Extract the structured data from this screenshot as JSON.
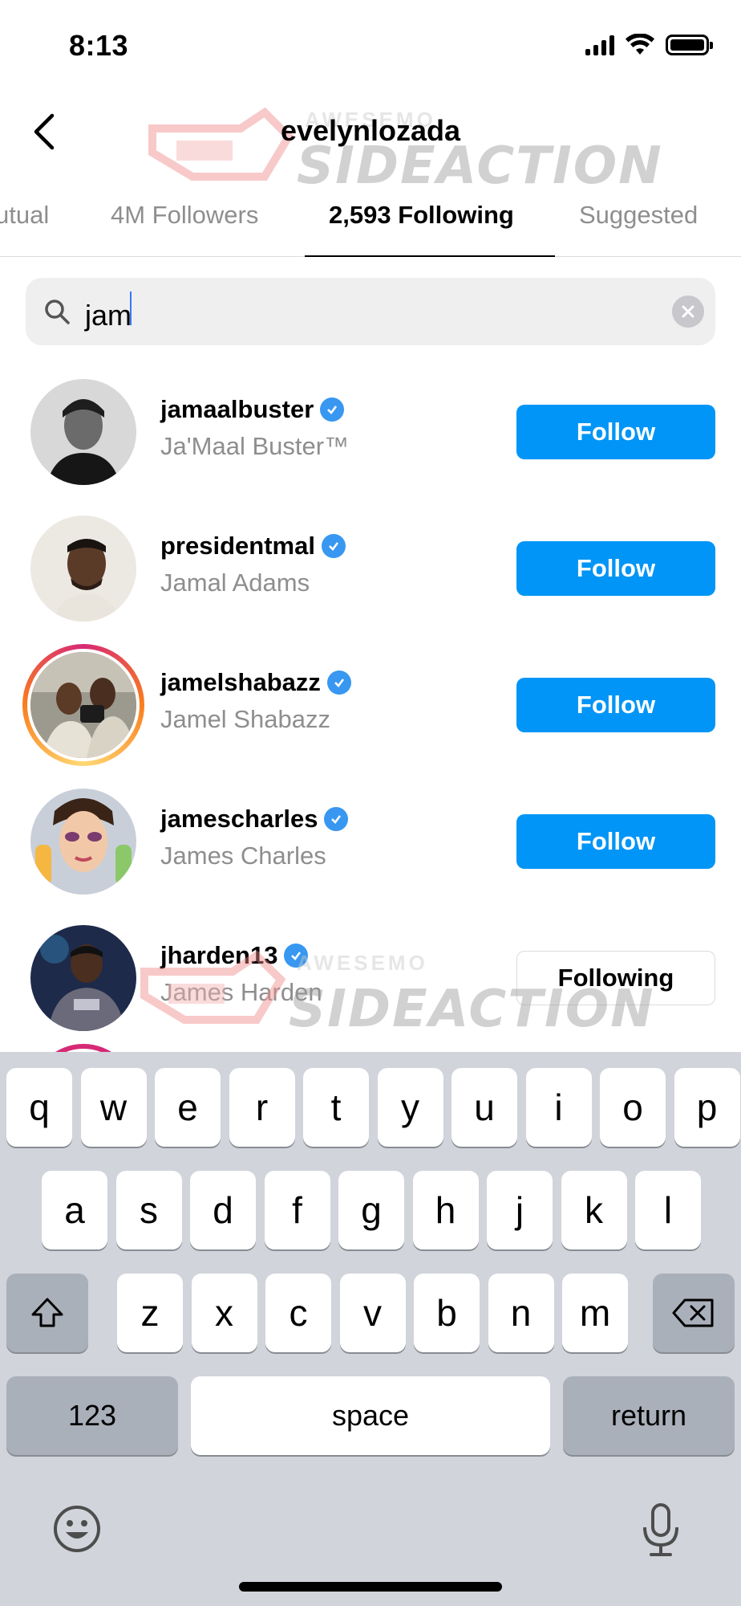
{
  "status_bar": {
    "time": "8:13"
  },
  "header": {
    "title": "evelynlozada"
  },
  "tabs": [
    {
      "label": "utual"
    },
    {
      "label": "4M Followers"
    },
    {
      "label": "2,593 Following",
      "active": true
    },
    {
      "label": "Suggested"
    }
  ],
  "search": {
    "value": "jam"
  },
  "accounts": [
    {
      "username": "jamaalbuster",
      "full_name": "Ja'Maal Buster™",
      "verified": true,
      "button": "Follow"
    },
    {
      "username": "presidentmal",
      "full_name": "Jamal Adams",
      "verified": true,
      "button": "Follow"
    },
    {
      "username": "jamelshabazz",
      "full_name": "Jamel Shabazz",
      "verified": true,
      "button": "Follow",
      "story_ring": true
    },
    {
      "username": "jamescharles",
      "full_name": "James Charles",
      "verified": true,
      "button": "Follow"
    },
    {
      "username": "jharden13",
      "full_name": "James Harden",
      "verified": true,
      "button": "Following"
    }
  ],
  "watermark": {
    "top": "AWESEMO",
    "main": "SIDEACTION"
  },
  "keyboard": {
    "row1": [
      "q",
      "w",
      "e",
      "r",
      "t",
      "y",
      "u",
      "i",
      "o",
      "p"
    ],
    "row2": [
      "a",
      "s",
      "d",
      "f",
      "g",
      "h",
      "j",
      "k",
      "l"
    ],
    "row3": [
      "z",
      "x",
      "c",
      "v",
      "b",
      "n",
      "m"
    ],
    "numbers_label": "123",
    "space_label": "space",
    "return_label": "return"
  },
  "colors": {
    "follow_blue": "#0095f6",
    "verified_blue": "#3897f0",
    "keyboard_bg": "#d1d4da"
  }
}
